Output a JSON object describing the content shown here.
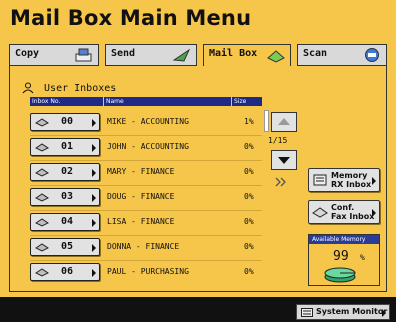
{
  "title": "Mail Box Main Menu",
  "tabs": [
    {
      "label": "Copy",
      "icon": "copy-icon"
    },
    {
      "label": "Send",
      "icon": "send-icon"
    },
    {
      "label": "Mail Box",
      "icon": "mailbox-icon",
      "active": true
    },
    {
      "label": "Scan",
      "icon": "scan-icon"
    }
  ],
  "inbox_header": "User Inboxes",
  "columns": {
    "no": "Inbox No.",
    "name": "Name",
    "size": "Size"
  },
  "rows": [
    {
      "no": "00",
      "name": "MIKE - ACCOUNTING",
      "size": "1%"
    },
    {
      "no": "01",
      "name": "JOHN - ACCOUNTING",
      "size": "0%"
    },
    {
      "no": "02",
      "name": "MARY - FINANCE",
      "size": "0%"
    },
    {
      "no": "03",
      "name": "DOUG - FINANCE",
      "size": "0%"
    },
    {
      "no": "04",
      "name": "LISA - FINANCE",
      "size": "0%"
    },
    {
      "no": "05",
      "name": "DONNA - FINANCE",
      "size": "0%"
    },
    {
      "no": "06",
      "name": "PAUL - PURCHASING",
      "size": "0%"
    }
  ],
  "pager": "1/15",
  "side_buttons": {
    "memory_rx": [
      "Memory",
      "RX Inbox"
    ],
    "conf_fax": [
      "Conf.",
      "Fax Inbox"
    ]
  },
  "memory": {
    "label": "Available Memory",
    "value": "99",
    "unit": "%"
  },
  "system_monitor": "System Monitor",
  "colors": {
    "background": "#f6c64a",
    "header_blue": "#1d2a86",
    "button_grey": "#e2e2e2"
  }
}
